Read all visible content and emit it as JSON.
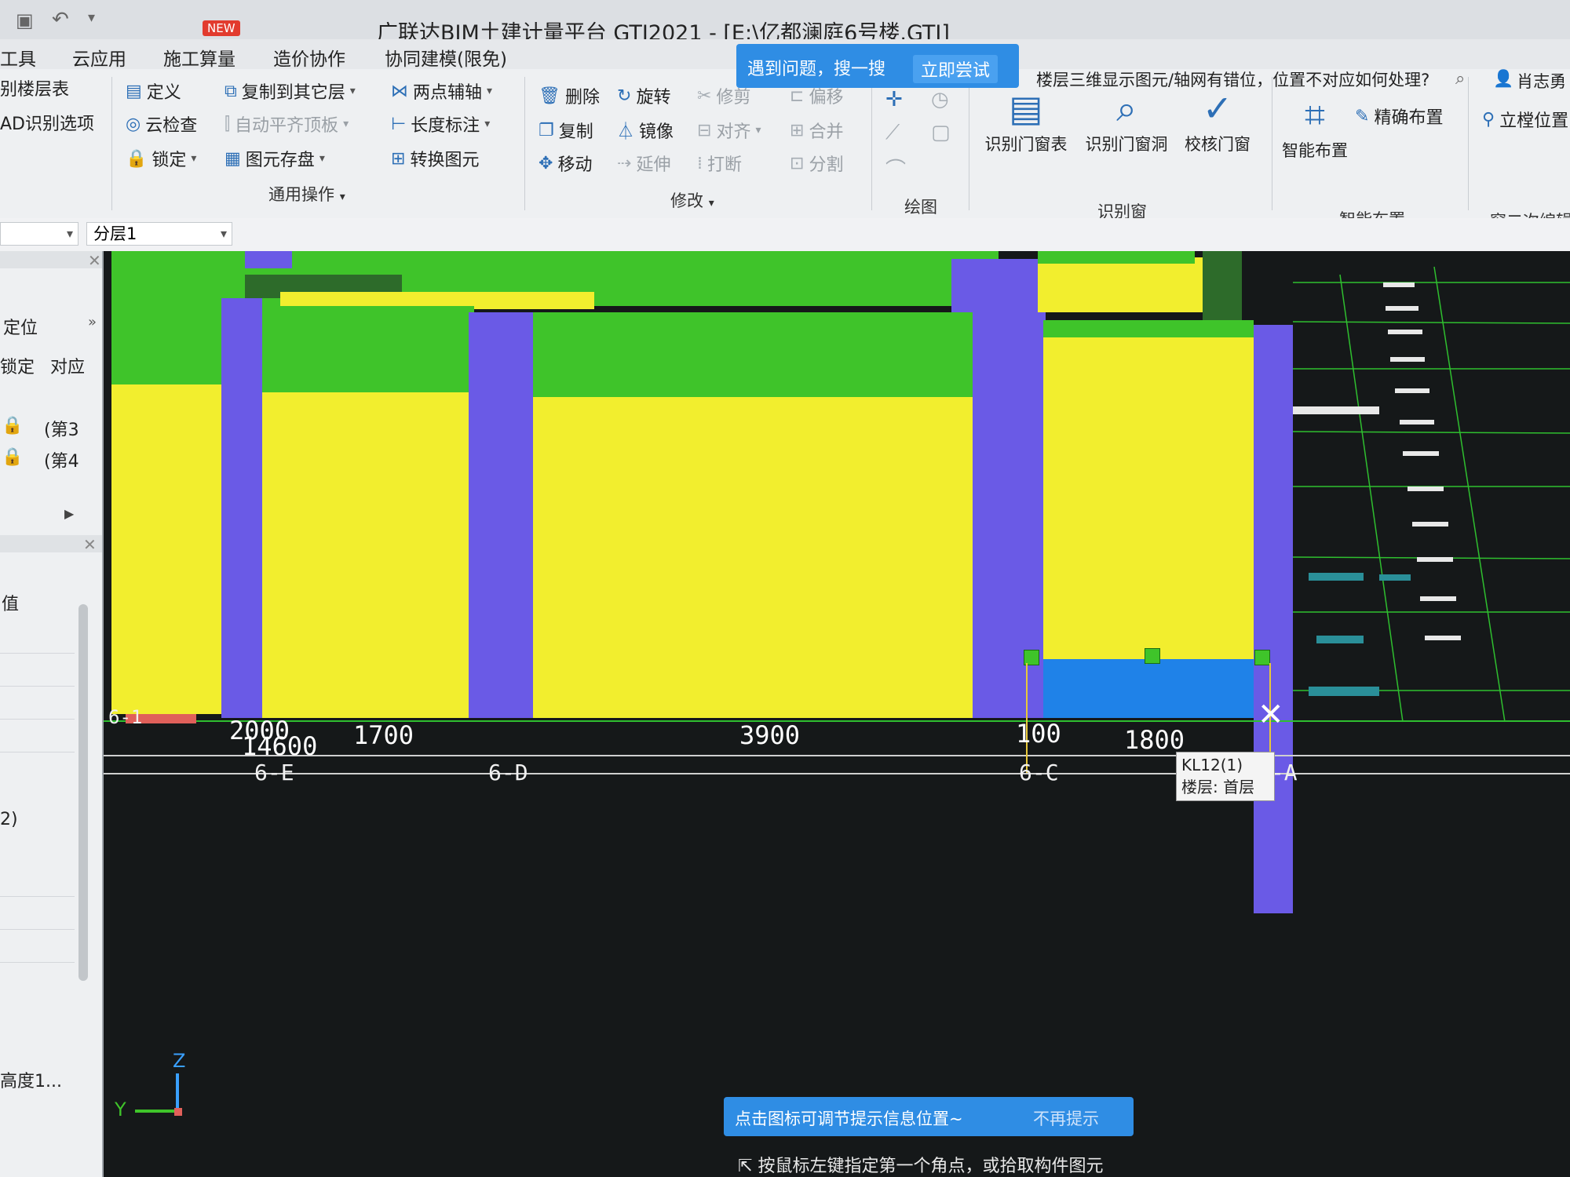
{
  "window": {
    "title": "广联达BIM土建计量平台 GTJ2021 - [E:\\亿都澜庭6号楼.GTJ]",
    "new_badge": "NEW"
  },
  "menu": [
    "工具",
    "云应用",
    "施工算量",
    "造价协作",
    "协同建模(限免)"
  ],
  "search_tip": {
    "text": "遇到问题，搜一搜",
    "button": "立即尝试"
  },
  "qa_text": "楼层三维显示图元/轴网有错位，位置不对应如何处理?",
  "user_name": "肖志勇",
  "ribbon": {
    "left_partial": [
      "别楼层表",
      "AD识别选项"
    ],
    "general": {
      "define": "定义",
      "cloud_check": "云检查",
      "lock": "锁定",
      "copy_to_floor": "复制到其它层",
      "auto_align_top": "自动平齐顶板",
      "element_save": "图元存盘",
      "two_point_axis": "两点辅轴",
      "length_dim": "长度标注",
      "convert_element": "转换图元",
      "label": "通用操作"
    },
    "modify": {
      "delete": "删除",
      "copy": "复制",
      "move": "移动",
      "rotate": "旋转",
      "mirror": "镜像",
      "extend": "延伸",
      "trim": "修剪",
      "align": "对齐",
      "break": "打断",
      "offset": "偏移",
      "merge": "合并",
      "split": "分割",
      "label": "修改"
    },
    "draw": {
      "label": "绘图"
    },
    "recognize_window": {
      "table": "识别门窗表",
      "opening": "识别门窗洞",
      "check": "校核门窗",
      "label": "识别窗"
    },
    "smart_layout": {
      "button": "智能布置",
      "precise": "精确布置",
      "label": "智能布置"
    },
    "right_partial": {
      "elevation": "立樘位置",
      "secondary_edit": "窗二次编辑"
    }
  },
  "floorbar": {
    "floor_dropdown": "",
    "layer_dropdown": "分层1"
  },
  "left_panel": {
    "locate": "定位",
    "lock": "锁定",
    "correspond": "对应",
    "items": [
      "(第3",
      "(第4"
    ],
    "value_header": "值",
    "bottom_item": "高度1...",
    "partial_a": "2)"
  },
  "canvas": {
    "axis_labels": [
      "6-E",
      "6-D",
      "6-C",
      "6-A"
    ],
    "dimensions": [
      "2000",
      "14600",
      "1700",
      "3900",
      "100",
      "1800"
    ],
    "corner_label": "6-1",
    "axes": {
      "z": "Z",
      "y": "Y"
    },
    "tooltip": {
      "name": "KL12(1)",
      "floor": "楼层: 首层"
    },
    "hint": {
      "text": "点击图标可调节提示信息位置~",
      "dismiss": "不再提示"
    },
    "status": "按鼠标左键指定第一个角点，或拾取构件图元",
    "colors": {
      "slab": "#f2ee2e",
      "beam": "#3fc42a",
      "column": "#6a5ae6",
      "selected": "#1f82e8"
    }
  }
}
